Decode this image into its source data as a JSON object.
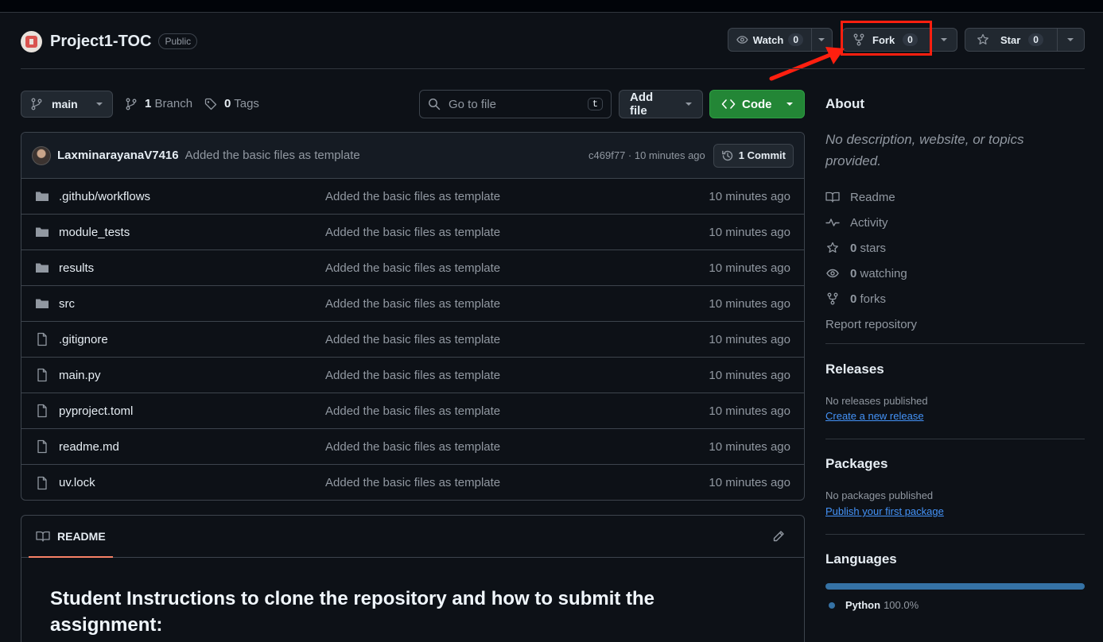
{
  "repo": {
    "name": "Project1-TOC",
    "visibility": "Public"
  },
  "header_actions": {
    "watch": {
      "label": "Watch",
      "count": "0"
    },
    "fork": {
      "label": "Fork",
      "count": "0"
    },
    "star": {
      "label": "Star",
      "count": "0"
    }
  },
  "toolbar": {
    "branch": "main",
    "branches_count": "1",
    "branches_label": "Branch",
    "tags_count": "0",
    "tags_label": "Tags",
    "search_placeholder": "Go to file",
    "search_shortcut": "t",
    "add_file": "Add file",
    "code": "Code"
  },
  "commit": {
    "author": "LaxminarayanaV7416",
    "message": "Added the basic files as template",
    "hash": "c469f77",
    "time": "· 10 minutes ago",
    "count_label": "1 Commit"
  },
  "files": [
    {
      "type": "folder",
      "name": ".github/workflows",
      "message": "Added the basic files as template",
      "date": "10 minutes ago"
    },
    {
      "type": "folder",
      "name": "module_tests",
      "message": "Added the basic files as template",
      "date": "10 minutes ago"
    },
    {
      "type": "folder",
      "name": "results",
      "message": "Added the basic files as template",
      "date": "10 minutes ago"
    },
    {
      "type": "folder",
      "name": "src",
      "message": "Added the basic files as template",
      "date": "10 minutes ago"
    },
    {
      "type": "file",
      "name": ".gitignore",
      "message": "Added the basic files as template",
      "date": "10 minutes ago"
    },
    {
      "type": "file",
      "name": "main.py",
      "message": "Added the basic files as template",
      "date": "10 minutes ago"
    },
    {
      "type": "file",
      "name": "pyproject.toml",
      "message": "Added the basic files as template",
      "date": "10 minutes ago"
    },
    {
      "type": "file",
      "name": "readme.md",
      "message": "Added the basic files as template",
      "date": "10 minutes ago"
    },
    {
      "type": "file",
      "name": "uv.lock",
      "message": "Added the basic files as template",
      "date": "10 minutes ago"
    }
  ],
  "readme": {
    "tab": "README",
    "title": "Student Instructions to clone the repository and how to submit the assignment:"
  },
  "about": {
    "heading": "About",
    "description": "No description, website, or topics provided.",
    "readme": "Readme",
    "activity": "Activity",
    "stars_count": "0",
    "stars_label": "stars",
    "watching_count": "0",
    "watching_label": "watching",
    "forks_count": "0",
    "forks_label": "forks",
    "report": "Report repository"
  },
  "releases": {
    "heading": "Releases",
    "none": "No releases published",
    "link": "Create a new release"
  },
  "packages": {
    "heading": "Packages",
    "none": "No packages published",
    "link": "Publish your first package"
  },
  "languages": {
    "heading": "Languages",
    "items": [
      {
        "name": "Python",
        "percent": "100.0%",
        "share": 1.0,
        "color": "#3572a5"
      }
    ]
  },
  "colors": {
    "accent_green": "#238636",
    "link": "#4493f8",
    "annotation_red": "#ff1f0f",
    "tab_underline": "#f78166"
  }
}
